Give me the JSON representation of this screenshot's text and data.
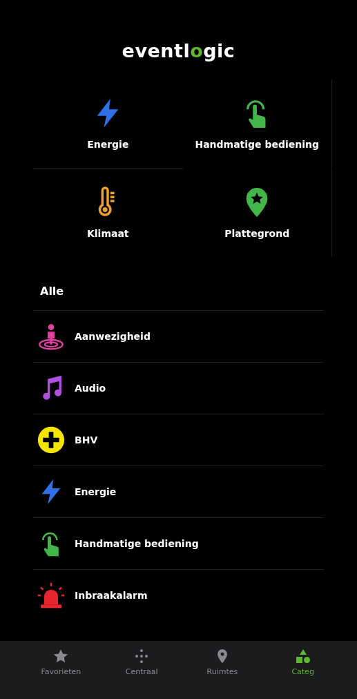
{
  "logo": {
    "before": "eventl",
    "accent": "o",
    "after": "gic"
  },
  "tiles": [
    {
      "kind": "energy",
      "label": "Energie"
    },
    {
      "kind": "manual",
      "label": "Handmatige bediening"
    },
    {
      "kind": "climate",
      "label": "Klimaat"
    },
    {
      "kind": "floorplan",
      "label": "Plattegrond"
    }
  ],
  "section_title": "Alle",
  "categories": [
    {
      "kind": "presence",
      "label": "Aanwezigheid"
    },
    {
      "kind": "audio",
      "label": "Audio"
    },
    {
      "kind": "firstaid",
      "label": "BHV"
    },
    {
      "kind": "energy",
      "label": "Energie"
    },
    {
      "kind": "manual",
      "label": "Handmatige bediening"
    },
    {
      "kind": "alarm",
      "label": "Inbraakalarm"
    }
  ],
  "tabs": [
    {
      "kind": "star",
      "label": "Favorieten",
      "selected": false
    },
    {
      "kind": "dots",
      "label": "Centraal",
      "selected": false
    },
    {
      "kind": "pin",
      "label": "Ruimtes",
      "selected": false
    },
    {
      "kind": "shapes",
      "label": "Categ",
      "selected": true
    }
  ]
}
